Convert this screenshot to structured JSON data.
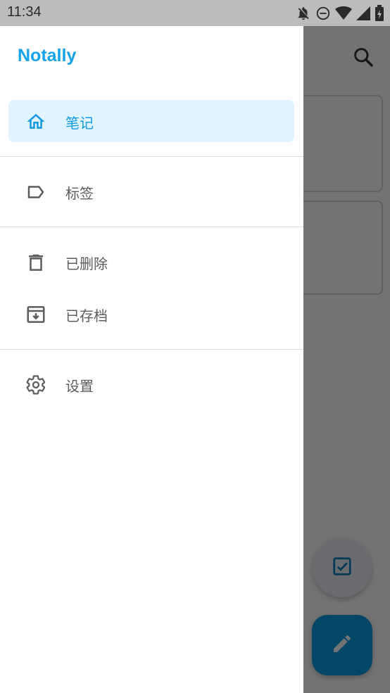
{
  "status_bar": {
    "time": "11:34",
    "icons": [
      "notifications-off-icon",
      "do-not-disturb-icon",
      "wifi-icon",
      "signal-icon",
      "battery-icon"
    ]
  },
  "drawer": {
    "title": "Notally",
    "items": [
      {
        "label": "笔记",
        "icon": "home-icon",
        "active": true
      },
      {
        "label": "标签",
        "icon": "label-icon",
        "active": false
      },
      {
        "label": "已删除",
        "icon": "trash-icon",
        "active": false
      },
      {
        "label": "已存档",
        "icon": "archive-icon",
        "active": false
      },
      {
        "label": "设置",
        "icon": "gear-icon",
        "active": false
      }
    ]
  },
  "background": {
    "icons": [
      "search-icon",
      "checkbox-icon",
      "pencil-icon"
    ]
  },
  "colors": {
    "accent": "#14a3e8",
    "active_background": "#e1f3fd",
    "fab": "#0a9ce4"
  }
}
